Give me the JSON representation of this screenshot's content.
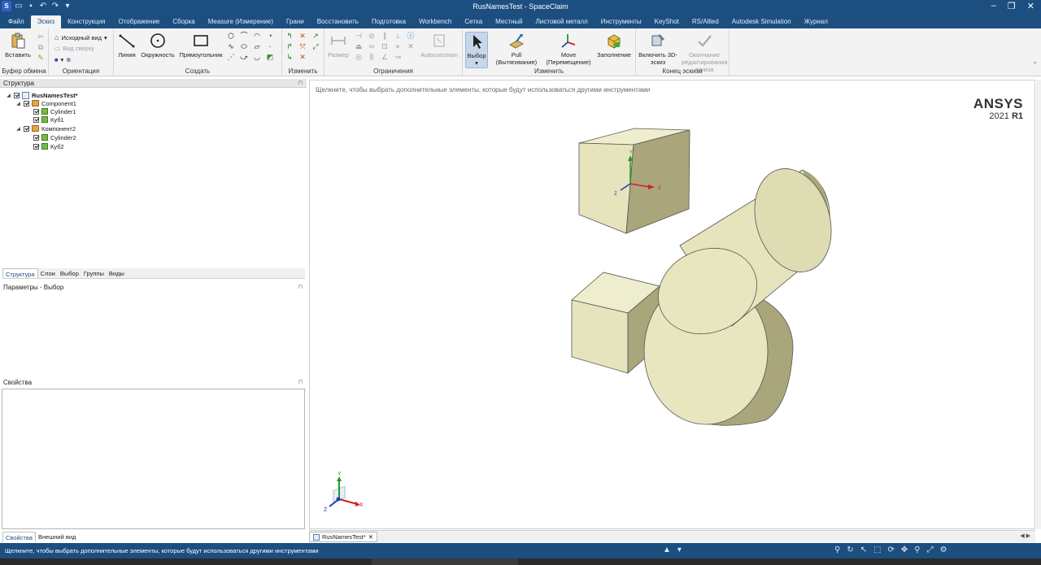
{
  "window": {
    "title": "RusNamesTest - SpaceClaim",
    "min_icon": "minimize-icon",
    "max_icon": "restore-icon",
    "close_icon": "close-icon"
  },
  "tabs": [
    "Файл",
    "Эскиз",
    "Конструкция",
    "Отображение",
    "Сборка",
    "Measure (Измерение)",
    "Грани",
    "Восстановить",
    "Подготовка",
    "Workbench",
    "Сетка",
    "Местный",
    "Листовой металл",
    "Инструменты",
    "KeyShot",
    "RS/Allied",
    "Autodesk Simulation",
    "Журнал"
  ],
  "active_tab": "Эскиз",
  "ribbon": {
    "clipboard": {
      "paste": "Вставить",
      "label": "Буфер обмена"
    },
    "orientation": {
      "home_view": "Исходный вид",
      "top_view": "Вид сверху",
      "label": "Ориентация"
    },
    "create": {
      "line": "Линия",
      "circle": "Окружность",
      "rectangle": "Прямоугольник",
      "label": "Создать"
    },
    "modify": {
      "label": "Изменить"
    },
    "constraints": {
      "dimension": "Размер",
      "autoconstrain": "Autoconstrain",
      "label": "Ограничения"
    },
    "edit": {
      "select": "Выбор",
      "pull": "Pull (Вытягивание)",
      "move_1": "Move",
      "move_2": "(Перемещение)",
      "fill": "Заполнение",
      "label": "Изменить"
    },
    "end_sketch": {
      "enable_3d_1": "Включить 3D-",
      "enable_3d_2": "эскиз",
      "finish_1": "Окончание",
      "finish_2": "редактирования",
      "finish_3": "эскиза",
      "label": "Конец эскиза"
    }
  },
  "structure": {
    "title": "Структура",
    "tree": [
      {
        "label": "RusNamesTest*",
        "level": 0
      },
      {
        "label": "Component1",
        "level": 1
      },
      {
        "label": "Cylinder1",
        "level": 2
      },
      {
        "label": "Куб1",
        "level": 2
      },
      {
        "label": "Компонент2",
        "level": 1
      },
      {
        "label": "Cylinder2",
        "level": 2
      },
      {
        "label": "Куб2",
        "level": 2
      }
    ]
  },
  "panel_tabs": [
    "Структура",
    "Слои",
    "Выбор",
    "Группы",
    "Виды"
  ],
  "options_title": "Параметры - Выбор",
  "properties_title": "Свойства",
  "bottom_tabs": [
    "Свойства",
    "Внешний вид"
  ],
  "viewport": {
    "hint": "Щелкните, чтобы выбрать дополнительные элементы, которые будут использоваться другими инструментами",
    "brand": "ANSYS",
    "version_year": "2021",
    "version_rel": "R1",
    "axis_x": "X",
    "axis_y": "Y",
    "axis_z": "Z"
  },
  "document_tab": "RusNamesTest*",
  "status": {
    "message": "Щелкните, чтобы выбрать дополнительные элементы, которые будут использоваться другими инструментами"
  },
  "colors": {
    "chrome_blue": "#1c4e80",
    "solid_face": "#e8e6bf",
    "solid_side": "#c9c79a",
    "axis_x": "#d42020",
    "axis_y": "#1f9a2a",
    "axis_z": "#1b3fb5"
  }
}
